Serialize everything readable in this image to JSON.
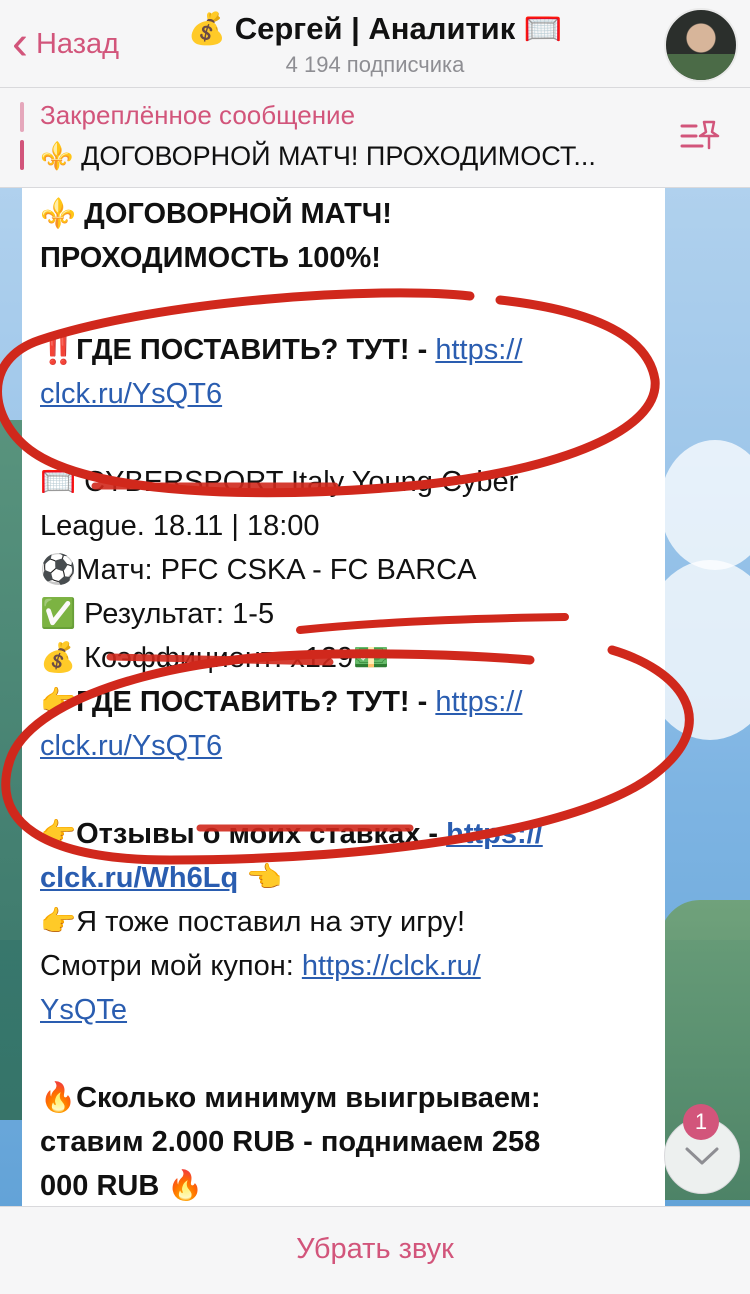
{
  "header": {
    "back_label": "Назад",
    "title": "💰 Сергей | Аналитик 🥅",
    "subtitle": "4 194 подписчика"
  },
  "pinned": {
    "title": "Закреплённое сообщение",
    "text": "⚜️ ДОГОВОРНОЙ МАТЧ! ПРОХОДИМОСТ..."
  },
  "message": {
    "heading_line1": "⚜️ ДОГОВОРНОЙ МАТЧ!",
    "heading_line2": "ПРОХОДИМОСТЬ 100%!",
    "where_bet_1_prefix": "‼️ГДЕ ПОСТАВИТЬ? ТУТ! - ",
    "where_bet_1_link_a": "https://",
    "where_bet_1_link_b": "clck.ru/YsQT6",
    "match_line1": "🥅 CYBERSPORT  Italy Young Cyber",
    "match_line2": "League. 18.11 | 18:00",
    "match_teams": "⚽Матч:  PFC CSKA - FC BARCA",
    "result": "✅ Результат: 1-5",
    "coefficient": "💰 Коэффициент: x129💵",
    "where_bet_2_prefix": "👉ГДЕ ПОСТАВИТЬ? ТУТ! - ",
    "where_bet_2_link_a": "https://",
    "where_bet_2_link_b": "clck.ru/YsQT6",
    "reviews_prefix": "👉Отзывы о моих ставках -  ",
    "reviews_link_a": "https://",
    "reviews_link_b": "clck.ru/Wh6Lq",
    "reviews_suffix": " 👈",
    "coupon_line1": "👉Я тоже поставил на эту игру!",
    "coupon_prefix": "Смотри мой купон: ",
    "coupon_link_a": "https://clck.ru/",
    "coupon_link_b": "YsQTe",
    "min_win_line1": "🔥Сколько минимум выигрываем:",
    "min_win_line2": "ставим 2.000 RUB - поднимаем 258",
    "min_win_line3": "000 RUB 🔥"
  },
  "scroll": {
    "badge_count": "1"
  },
  "bottom": {
    "mute_label": "Убрать звук"
  },
  "colors": {
    "accent": "#d2557b",
    "link": "#2a5db0",
    "annotation": "#d0281c"
  },
  "icons": {
    "back": "chevron-left-icon",
    "pin": "pin-list-icon",
    "scroll": "chevron-down-icon"
  }
}
